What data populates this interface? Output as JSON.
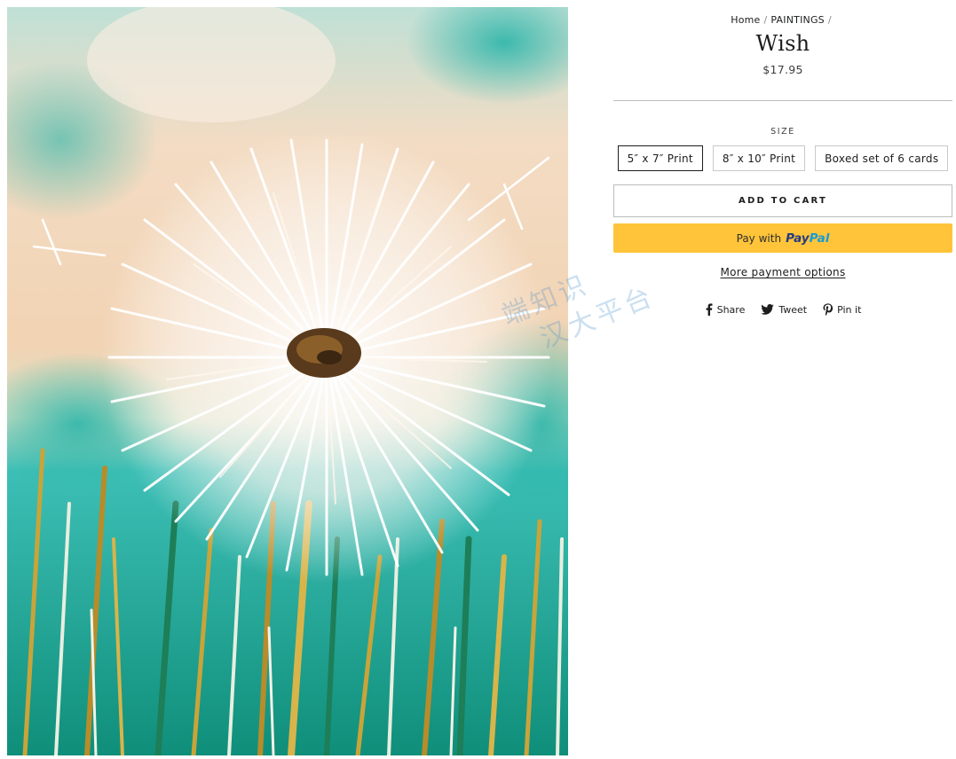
{
  "breadcrumb": {
    "home": "Home",
    "separator": "/",
    "category": "PAINTINGS"
  },
  "product": {
    "title": "Wish",
    "price": "$17.95"
  },
  "size": {
    "label": "SIZE",
    "options": [
      {
        "label": "5″ x 7″ Print",
        "selected": true
      },
      {
        "label": "8″ x 10″ Print",
        "selected": false
      },
      {
        "label": "Boxed set of 6 cards",
        "selected": false
      }
    ]
  },
  "actions": {
    "add_to_cart": "ADD TO CART",
    "paypal_prefix": "Pay with",
    "paypal_brand_pay": "Pay",
    "paypal_brand_pal": "Pal",
    "more_payment": "More payment options"
  },
  "social": {
    "share": "Share",
    "tweet": "Tweet",
    "pin": "Pin it"
  },
  "watermark": {
    "line1": "端知识",
    "line2": "汉大平台"
  },
  "colors": {
    "paypal_button": "#ffc439",
    "paypal_dark_blue": "#253b80",
    "paypal_light_blue": "#179bd7",
    "text": "#1c1d1d"
  },
  "icons": {
    "share": "facebook-icon",
    "tweet": "twitter-icon",
    "pin": "pinterest-icon"
  }
}
